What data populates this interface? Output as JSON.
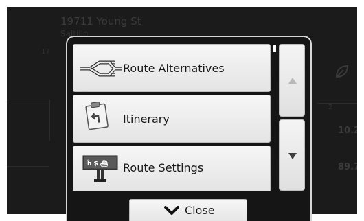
{
  "background": {
    "address_line": "19711 Young St",
    "address_sub": "Saltillo",
    "right_values": [
      "10.2",
      "89.7"
    ],
    "small_labels": [
      "2",
      "17"
    ]
  },
  "menu": {
    "items": [
      {
        "label": "Route Alternatives",
        "icon": "route-alternatives-icon"
      },
      {
        "label": "Itinerary",
        "icon": "itinerary-icon"
      },
      {
        "label": "Route Settings",
        "icon": "route-settings-icon"
      }
    ]
  },
  "scroll": {
    "up_icon": "arrow-up-icon",
    "down_icon": "arrow-down-icon"
  },
  "close_button": {
    "label": "Close",
    "icon": "chevron-down-icon"
  },
  "colors": {
    "panel_bg": "#151515",
    "item_bg": "#eeeeee",
    "border": "#d7d7d7"
  }
}
